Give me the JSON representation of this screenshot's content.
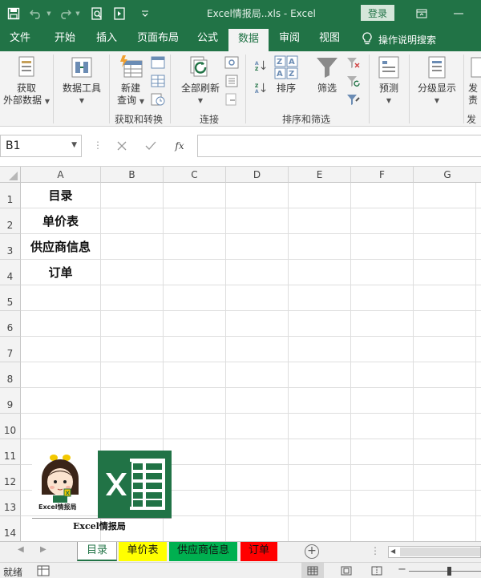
{
  "window": {
    "title": "Excel情报局..xls  -  Excel",
    "login_label": "登录",
    "quick_access_icons": [
      "save-icon",
      "undo-icon",
      "redo-icon",
      "print-preview-icon",
      "form-icon",
      "customize-qat-icon"
    ],
    "window_icons": [
      "ribbon-display-icon",
      "minimize-icon"
    ]
  },
  "ribbon_tabs": [
    {
      "label": "文件"
    },
    {
      "label": "开始"
    },
    {
      "label": "插入"
    },
    {
      "label": "页面布局"
    },
    {
      "label": "公式"
    },
    {
      "label": "数据",
      "active": true
    },
    {
      "label": "审阅"
    },
    {
      "label": "视图"
    }
  ],
  "tell_me": "操作说明搜索",
  "ribbon": {
    "get_external_data": {
      "line1": "获取",
      "line2": "外部数据"
    },
    "data_tools": {
      "line1": "数据工具"
    },
    "new_query": {
      "line1": "新建",
      "line2": "查询"
    },
    "refresh_all": {
      "line1": "全部刷新"
    },
    "sort": "排序",
    "filter": "筛选",
    "forecast": "预测",
    "outline": "分级显示",
    "publish_partial": {
      "line1": "发",
      "line2": "责"
    },
    "groups": {
      "get_transform": "获取和转换",
      "connections": "连接",
      "sort_filter": "排序和筛选",
      "publish_partial": "发"
    }
  },
  "formula_bar": {
    "name_box": "B1",
    "formula": "",
    "fx_label": "fx"
  },
  "columns": [
    "A",
    "B",
    "C",
    "D",
    "E",
    "F",
    "G"
  ],
  "rows": [
    "1",
    "2",
    "3",
    "4",
    "5",
    "6",
    "7",
    "8",
    "9",
    "10",
    "11",
    "12",
    "13",
    "14"
  ],
  "cells": {
    "A1": "目录",
    "A2": "单价表",
    "A3": "供应商信息",
    "A4": "订单"
  },
  "logo": {
    "mascot_caption": "Excel情报局",
    "caption": "Excel情报局"
  },
  "sheets": [
    {
      "label": "目录",
      "color": "#ffffff",
      "active": true
    },
    {
      "label": "单价表",
      "color": "#ffff00"
    },
    {
      "label": "供应商信息",
      "color": "#00b050"
    },
    {
      "label": "订单",
      "color": "#ff0000"
    }
  ],
  "status": {
    "mode": "就绪"
  },
  "colors": {
    "excel_green": "#217346",
    "ribbon_bg": "#f3f3f3"
  }
}
